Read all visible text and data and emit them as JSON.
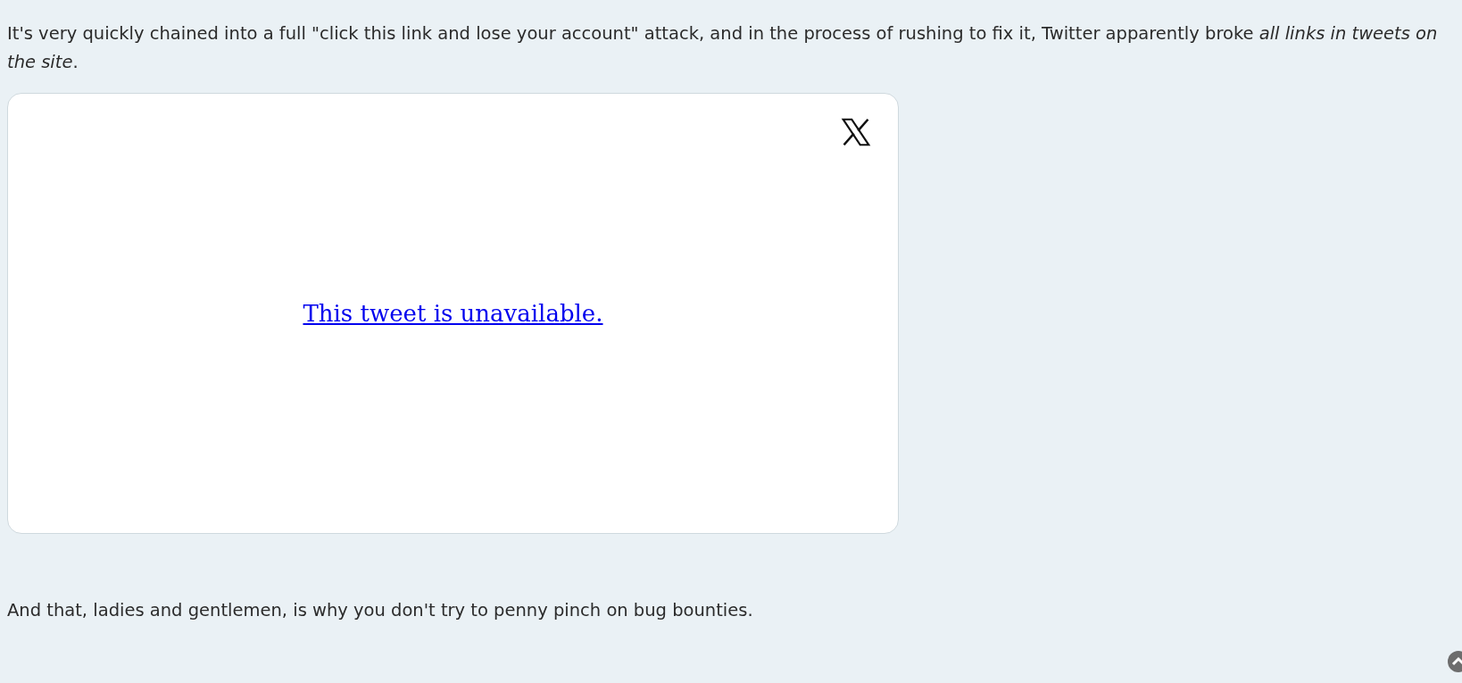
{
  "paragraphs": [
    "It's very quickly chained into a full \"click this link and lose your account\" attack, and in the process of rushing to fix it, Twitter apparently broke *all links in tweets on the site*.",
    "And that, ladies and gentlemen, is why you don't try to penny pinch on bug bounties."
  ],
  "embed": {
    "link": "This tweet is unavailable."
  }
}
